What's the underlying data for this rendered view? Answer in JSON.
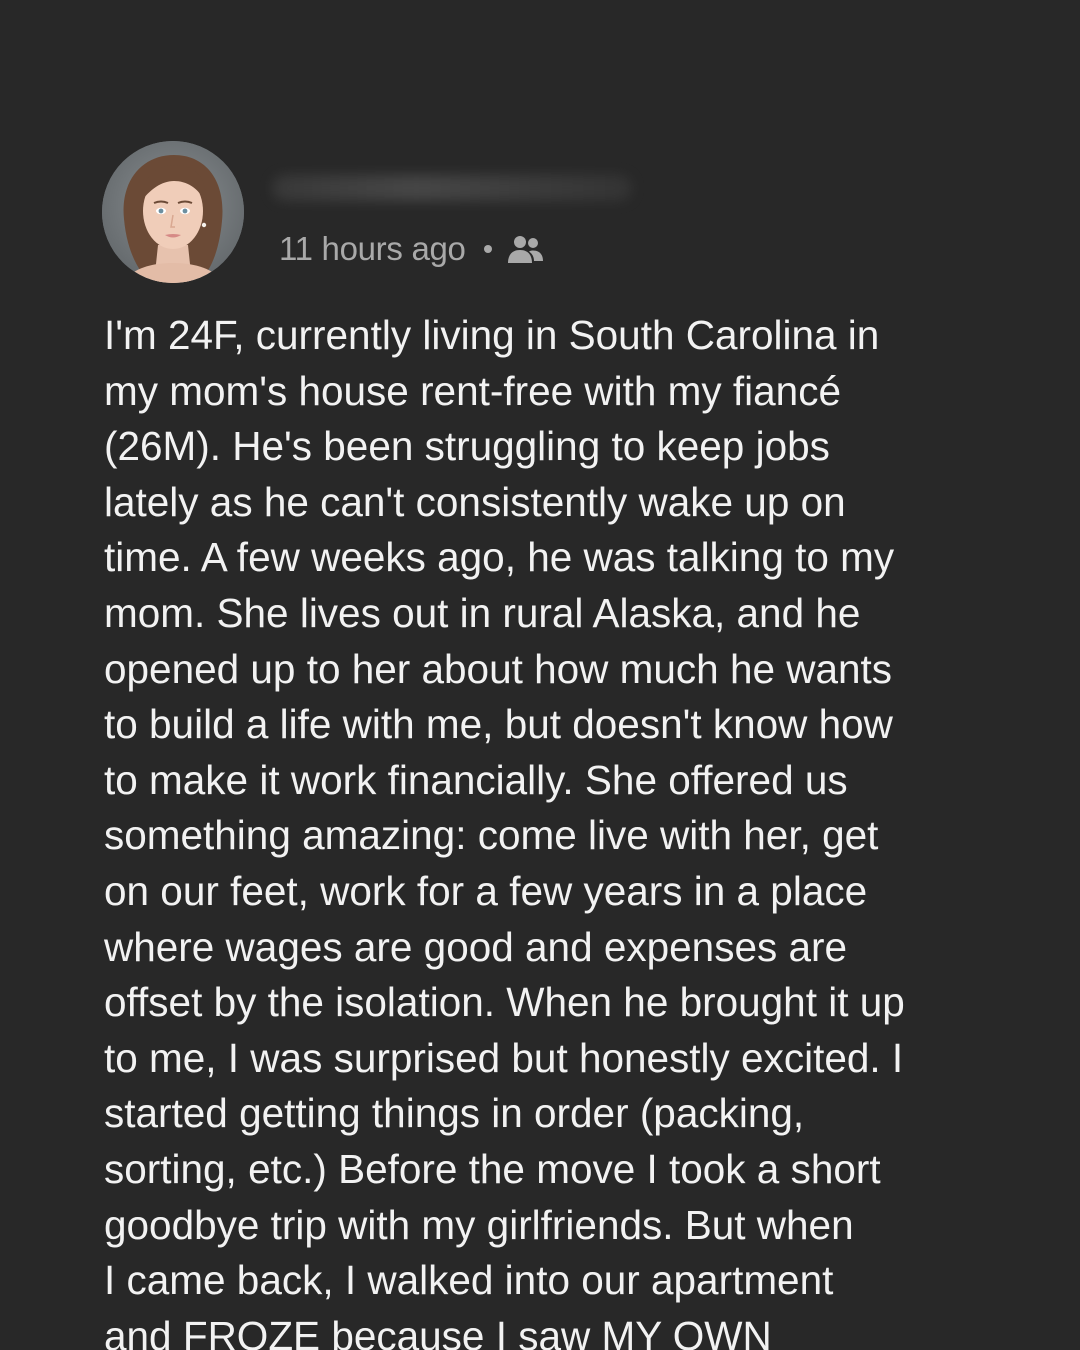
{
  "post": {
    "author_name": "",
    "timestamp": "11 hours ago",
    "separator": "•",
    "audience_icon": "friends-icon",
    "avatar_icon": "profile-photo",
    "body": "I'm 24F, currently living in South Carolina in\nmy mom's house rent-free with my fiancé\n(26M). He's been struggling to keep jobs\nlately as he can't consistently wake up on\ntime. A few weeks ago, he was talking to my\nmom. She lives out in rural Alaska, and he\nopened up to her about how much he wants\nto build a life with me, but doesn't know how\nto make it work financially. She offered us\nsomething amazing: come live with her, get\non our feet, work for a few years in a place\nwhere wages are good and expenses are\noffset by the isolation. When he brought it up\nto me, I was surprised but honestly excited. I\nstarted getting things in order (packing,\nsorting, etc.) Before the move I took a short\ngoodbye trip with my girlfriends. But when\nI came back, I walked into our apartment\nand FROZE because I saw MY OWN"
  },
  "colors": {
    "background": "#282828",
    "text": "#f2f2f2",
    "meta_text": "#a9a9a9"
  }
}
